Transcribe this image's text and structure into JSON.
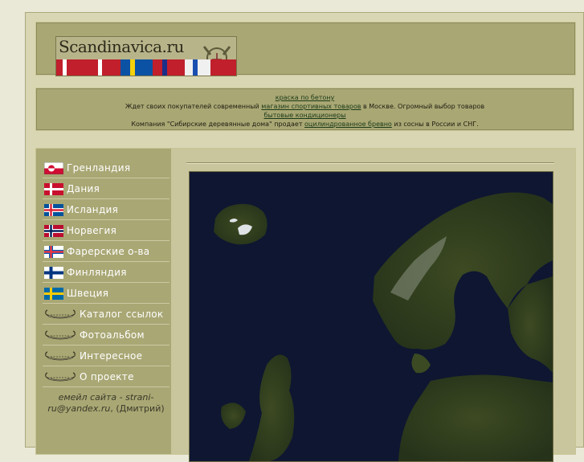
{
  "header": {
    "logo_text": "Scandinavica.ru"
  },
  "ads": {
    "line1_link": "краска по бетону",
    "line2_pre": "Ждет своих покупателей современный ",
    "line2_link": "магазин спортивных товаров",
    "line2_post": " в Москве. Огромный выбор товаров",
    "line3_link": "бытовые кондиционеры",
    "line4_pre": "Компания \"Сибирские деревянные дома\" продает ",
    "line4_link": "оцилиндрованное бревно",
    "line4_post": " из сосны в России и СНГ."
  },
  "menu": {
    "items": [
      {
        "label": "Гренландия",
        "icon": "greenland-flag-icon"
      },
      {
        "label": "Дания",
        "icon": "denmark-flag-icon"
      },
      {
        "label": "Исландия",
        "icon": "iceland-flag-icon"
      },
      {
        "label": "Норвегия",
        "icon": "norway-flag-icon"
      },
      {
        "label": "Фарерские о-ва",
        "icon": "faroe-flag-icon"
      },
      {
        "label": "Финляндия",
        "icon": "finland-flag-icon"
      },
      {
        "label": "Швеция",
        "icon": "sweden-flag-icon"
      },
      {
        "label": "Каталог ссылок",
        "icon": "viking-ship-icon"
      },
      {
        "label": "Фотоальбом",
        "icon": "viking-ship-icon"
      },
      {
        "label": "Интересное",
        "icon": "viking-ship-icon"
      },
      {
        "label": "О проекте",
        "icon": "viking-ship-icon"
      }
    ]
  },
  "contact": {
    "email_label": "емейл сайта - strani-ru@yandex.ru",
    "name": ", (Дмитрий)"
  },
  "colors": {
    "panel": "#a9a774",
    "background": "#d9d6b3",
    "link": "#1a3a16"
  }
}
